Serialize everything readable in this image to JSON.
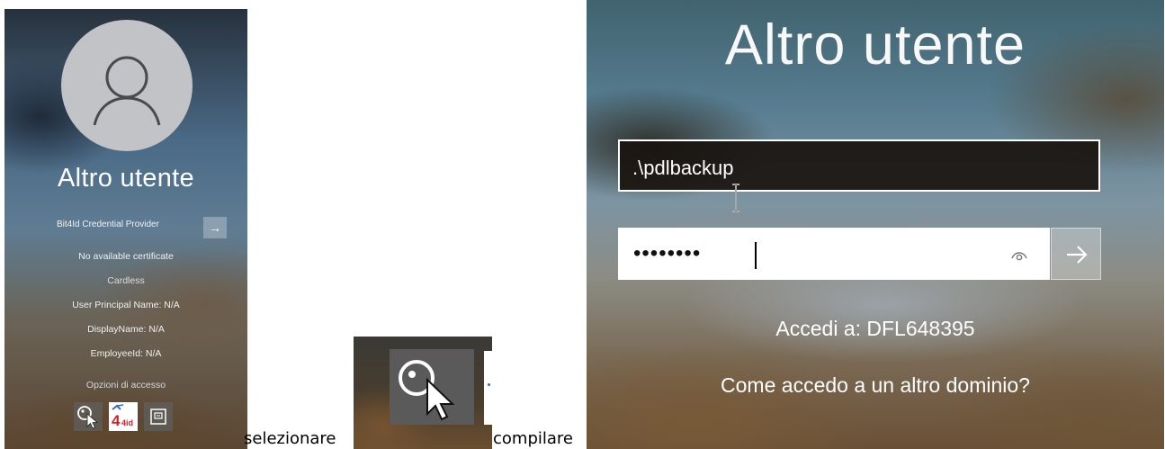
{
  "left_panel": {
    "user_name": "Altro utente",
    "provider": {
      "label": "Bit4Id Credential Provider",
      "arrow": "→"
    },
    "info_lines": [
      "No available certificate",
      "Cardless",
      "User Principal Name: N/A",
      "DisplayName: N/A",
      "EmployeeId: N/A"
    ],
    "sign_in_options_label": "Opzioni di accesso",
    "sign_in_options": [
      {
        "icon": "key-cursor-icon"
      },
      {
        "icon": "bit4id-logo",
        "text": "4id"
      },
      {
        "icon": "pin-card-icon"
      }
    ]
  },
  "captions": {
    "select": "selezionare",
    "fill": "compilare"
  },
  "zoom_panel": {
    "icon": "key-cursor-icon"
  },
  "right_panel": {
    "user_name": "Altro utente",
    "username_value": ".\\pdlbackup",
    "password_masked": "••••••••",
    "submit_arrow": "→",
    "sign_in_target": "Accedi a: DFL648395",
    "other_domain_link": "Come accedo a un altro dominio?"
  },
  "colors": {
    "text": "#ffffff",
    "field_dark": "#19140f",
    "field_light": "#ffffff"
  }
}
